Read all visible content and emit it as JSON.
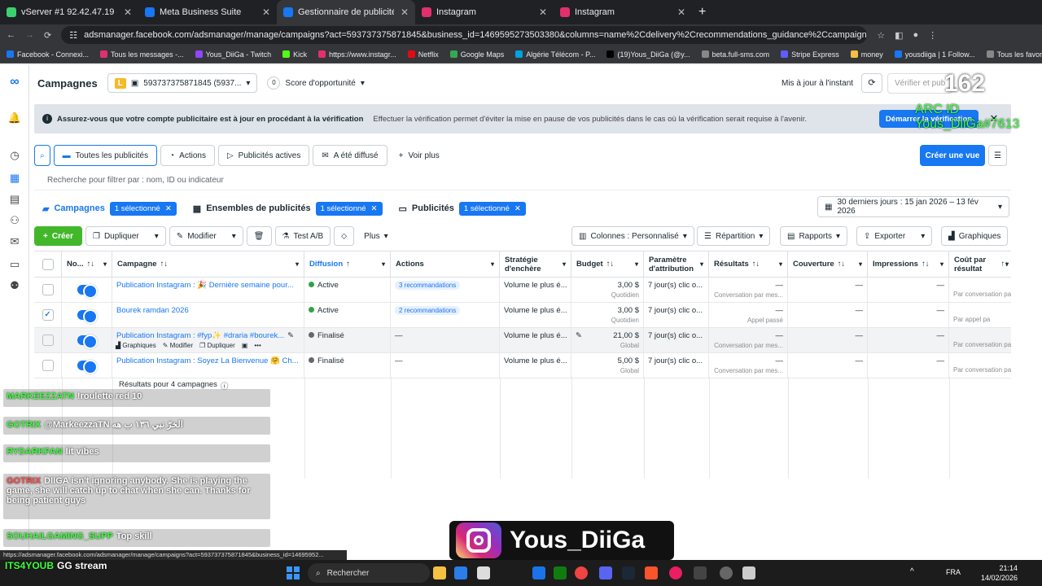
{
  "browser": {
    "tabs": [
      {
        "title": "vServer #1 92.42.47.19 - Overvie",
        "color": "#3bd16f"
      },
      {
        "title": "Meta Business Suite",
        "color": "#1877f2"
      },
      {
        "title": "Gestionnaire de publicités - Gé",
        "color": "#1877f2",
        "active": true
      },
      {
        "title": "Instagram",
        "color": "#e1306c"
      },
      {
        "title": "Instagram",
        "color": "#e1306c"
      }
    ],
    "url": "adsmanager.facebook.com/adsmanager/manage/campaigns?act=593737375871845&business_id=1469595273503380&columns=name%2Cdelivery%2Crecommendations_guidance%2Ccampaign_name%2Cbid%2Cbudget%2...",
    "bookmarks": [
      "Facebook - Connexi...",
      "Tous les messages -...",
      "Yous_DiiGa - Twitch",
      "Kick",
      "https://www.instagr...",
      "Netflix",
      "Google Maps",
      "Algérie Télécom - P...",
      "(19)Yous_DiiGa (@y...",
      "beta.full-sms.com",
      "Stripe Express",
      "money",
      "yousdiiga | 1 Follow...",
      "Tous les favoris"
    ]
  },
  "header": {
    "title": "Campagnes",
    "account_initial": "L",
    "account": "593737375871845 (5937...",
    "score_value": "0",
    "score_label": "Score d'opportunité",
    "updated": "Mis à jour à l'instant",
    "verify": "Vérifier et pub"
  },
  "banner": {
    "title": "Assurez-vous que votre compte publicitaire est à jour en procédant à la vérification",
    "text": "Effectuer la vérification permet d'éviter la mise en pause de vos publicités dans le cas où la vérification serait requise à l'avenir.",
    "button": "Démarrer la vérification"
  },
  "filters": {
    "items": [
      "Toutes les publicités",
      "Actions",
      "Publicités actives",
      "A été diffusé",
      "Voir plus"
    ],
    "create_view": "Créer une vue",
    "search_placeholder": "Recherche pour filtrer par : nom, ID ou indicateur"
  },
  "levels": {
    "campaigns": "Campagnes",
    "adsets": "Ensembles de publicités",
    "ads": "Publicités",
    "selected": "1 sélectionné",
    "date": "30 derniers jours : 15 jan 2026 – 13 fév 2026"
  },
  "toolbar": {
    "create": "Créer",
    "duplicate": "Dupliquer",
    "edit": "Modifier",
    "ab": "Test A/B",
    "more": "Plus",
    "columns": "Colonnes : Personnalisé",
    "breakdown": "Répartition",
    "reports": "Rapports",
    "export": "Exporter",
    "charts": "Graphiques"
  },
  "table": {
    "headers": [
      "No...",
      "Campagne",
      "Diffusion",
      "Actions",
      "Stratégie d'enchère",
      "Budget",
      "Paramètre d'attribution",
      "Résultats",
      "Couverture",
      "Impressions",
      "Coût par résultat"
    ],
    "rows": [
      {
        "name": "Publication Instagram : 🎉 Dernière semaine pour...",
        "status": "Active",
        "status_color": "#31a24c",
        "actions": "3 recommandations",
        "strategy": "Volume le plus é...",
        "budget": "3,00 $",
        "budget_type": "Quotidien",
        "attribution": "7 jour(s) clic o...",
        "results": "—",
        "results_sub": "Conversation par mes...",
        "reach": "—",
        "impressions": "—",
        "cpr_sub": "Par conversation par",
        "checked": false
      },
      {
        "name": "Bourek ramdan 2026",
        "status": "Active",
        "status_color": "#31a24c",
        "actions": "2 recommandations",
        "strategy": "Volume le plus é...",
        "budget": "3,00 $",
        "budget_type": "Quotidien",
        "attribution": "7 jour(s) clic o...",
        "results": "—",
        "results_sub": "Appel passé",
        "reach": "—",
        "impressions": "—",
        "cpr_sub": "Par appel pa",
        "checked": true
      },
      {
        "name": "Publication Instagram : #fyp✨ #draria #bourek...",
        "status": "Finalisé",
        "status_color": "#65676b",
        "actions": "—",
        "strategy": "Volume le plus é...",
        "budget": "21,00 $",
        "budget_type": "Global",
        "attribution": "7 jour(s) clic o...",
        "results": "—",
        "results_sub": "Conversation par mes...",
        "reach": "—",
        "impressions": "—",
        "cpr_sub": "Par conversation par",
        "checked": false
      },
      {
        "name": "Publication Instagram : Soyez La Bienvenue 🤗 Ch...",
        "status": "Finalisé",
        "status_color": "#65676b",
        "actions": "—",
        "strategy": "Volume le plus é...",
        "budget": "5,00 $",
        "budget_type": "Global",
        "attribution": "7 jour(s) clic o...",
        "results": "—",
        "results_sub": "Conversation par mes...",
        "reach": "—",
        "impressions": "—",
        "cpr_sub": "Par conversation par",
        "checked": false
      }
    ],
    "hover_actions": [
      "Graphiques",
      "Modifier",
      "Dupliquer"
    ],
    "footer": "Résultats pour 4 campagnes"
  },
  "chat": [
    {
      "user": "MARKEEZZATN",
      "text": "!roulette red 10",
      "color": "#3cff3c"
    },
    {
      "user": "GOTRIX",
      "text": "@MarkeezzaTN الخرّ نبي ١٣٦ ب هه",
      "color": "#3cff3c"
    },
    {
      "user": "RYDARKFAN",
      "text": "lit vibes",
      "color": "#3cff3c"
    },
    {
      "user": "GOTRIX",
      "text": "DIIGA isn't ignoring anybody. She is playing the game, she will catch up to chat when she can. Thanks for being patient guys",
      "color": "#ff4d4d"
    },
    {
      "user": "SOUHAILGAMING_SUPP",
      "text": "Top skill",
      "color": "#3cff3c"
    },
    {
      "user": "ITS4YOUB",
      "text": "GG stream",
      "color": "#3cff3c"
    }
  ],
  "overlay": {
    "count": "162",
    "arc": "ARC ID",
    "tag": "Yous_DiiGa#7613",
    "promo": "Yous_DiiGa"
  },
  "status_url": "https://adsmanager.facebook.com/adsmanager/manage/campaigns?act=593737375871845&business_id=14695952...",
  "taskbar": {
    "search": "Rechercher",
    "lang": "FRA",
    "time": "21:14",
    "date": "14/02/2026"
  }
}
